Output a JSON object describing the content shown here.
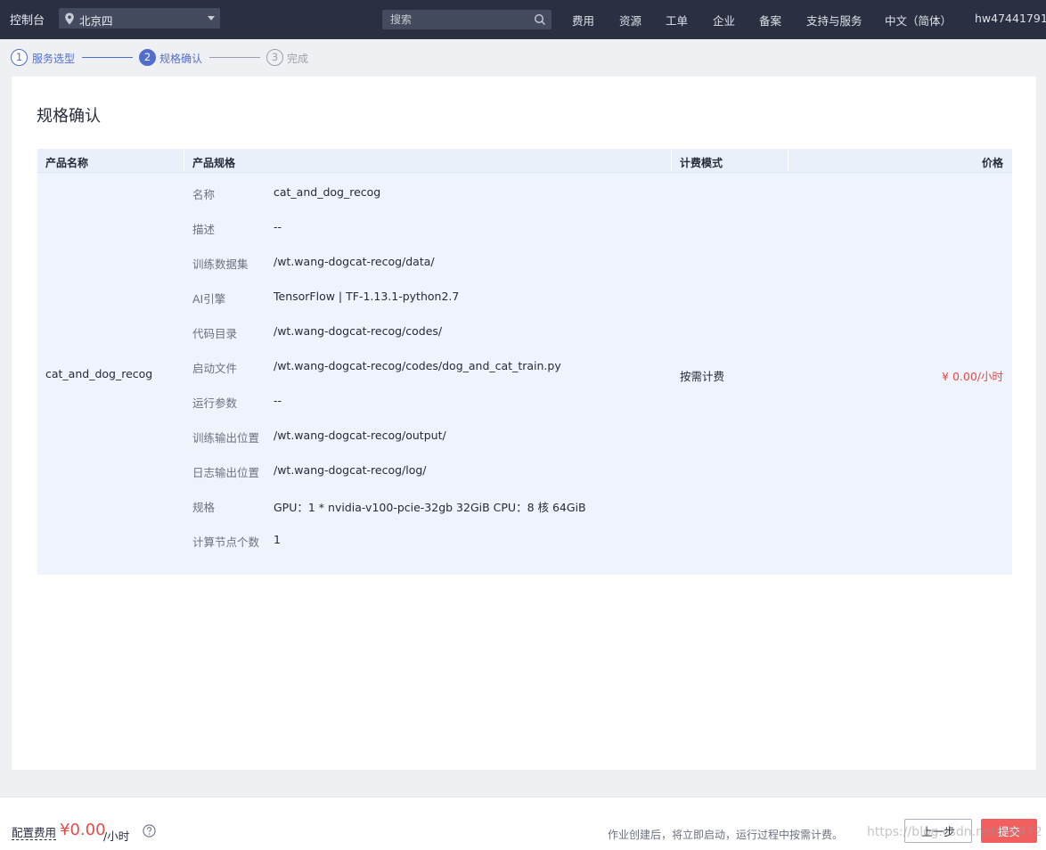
{
  "topbar": {
    "console": "控制台",
    "region": "北京四",
    "search_placeholder": "搜索",
    "nav": [
      "费用",
      "资源",
      "工单",
      "企业",
      "备案",
      "支持与服务",
      "中文（简体）",
      "hw47441791"
    ]
  },
  "steps": [
    {
      "num": "1",
      "label": "服务选型",
      "state": "done"
    },
    {
      "num": "2",
      "label": "规格确认",
      "state": "active"
    },
    {
      "num": "3",
      "label": "完成",
      "state": "todo"
    }
  ],
  "page_title": "规格确认",
  "table": {
    "headers": {
      "name": "产品名称",
      "spec": "产品规格",
      "billing": "计费模式",
      "price": "价格"
    },
    "product_name": "cat_and_dog_recog",
    "billing_mode": "按需计费",
    "price": "¥ 0.00/小时",
    "specs": [
      {
        "key": "名称",
        "value": "cat_and_dog_recog"
      },
      {
        "key": "描述",
        "value": "--"
      },
      {
        "key": "训练数据集",
        "value": "/wt.wang-dogcat-recog/data/"
      },
      {
        "key": "AI引擎",
        "value": "TensorFlow | TF-1.13.1-python2.7"
      },
      {
        "key": "代码目录",
        "value": "/wt.wang-dogcat-recog/codes/"
      },
      {
        "key": "启动文件",
        "value": "/wt.wang-dogcat-recog/codes/dog_and_cat_train.py"
      },
      {
        "key": "运行参数",
        "value": "--"
      },
      {
        "key": "训练输出位置",
        "value": "/wt.wang-dogcat-recog/output/"
      },
      {
        "key": "日志输出位置",
        "value": "/wt.wang-dogcat-recog/log/"
      },
      {
        "key": "规格",
        "value": "GPU：1 * nvidia-v100-pcie-32gb 32GiB CPU：8 核 64GiB"
      },
      {
        "key": "计算节点个数",
        "value": "1"
      }
    ]
  },
  "footer": {
    "fee_label": "配置费用",
    "fee_value": "¥0.00",
    "fee_unit": "/小时",
    "note": "作业创建后，将立即启动，运行过程中按需计费。",
    "prev_button": "上一步",
    "submit_button": "提交",
    "watermark": "https://blog.csdn.net/hw472"
  },
  "colors": {
    "accent": "#526ecc",
    "price": "#e34a4a",
    "topbar": "#2a3042",
    "submit": "#f25f5f"
  }
}
